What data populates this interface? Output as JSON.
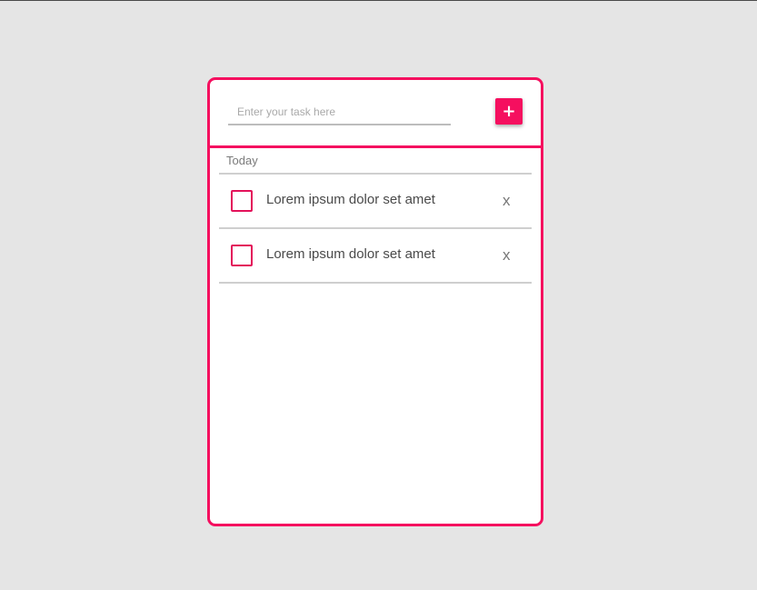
{
  "input": {
    "placeholder": "Enter your task here",
    "value": ""
  },
  "add_button": {
    "label": "+"
  },
  "section": {
    "label": "Today"
  },
  "tasks": [
    {
      "text": "Lorem ipsum dolor set amet",
      "checked": false,
      "delete_label": "x"
    },
    {
      "text": "Lorem ipsum dolor set amet",
      "checked": false,
      "delete_label": "x"
    }
  ],
  "colors": {
    "accent": "#f50f5f",
    "background": "#e5e5e5",
    "card": "#ffffff",
    "divider": "#cfcfcf"
  }
}
